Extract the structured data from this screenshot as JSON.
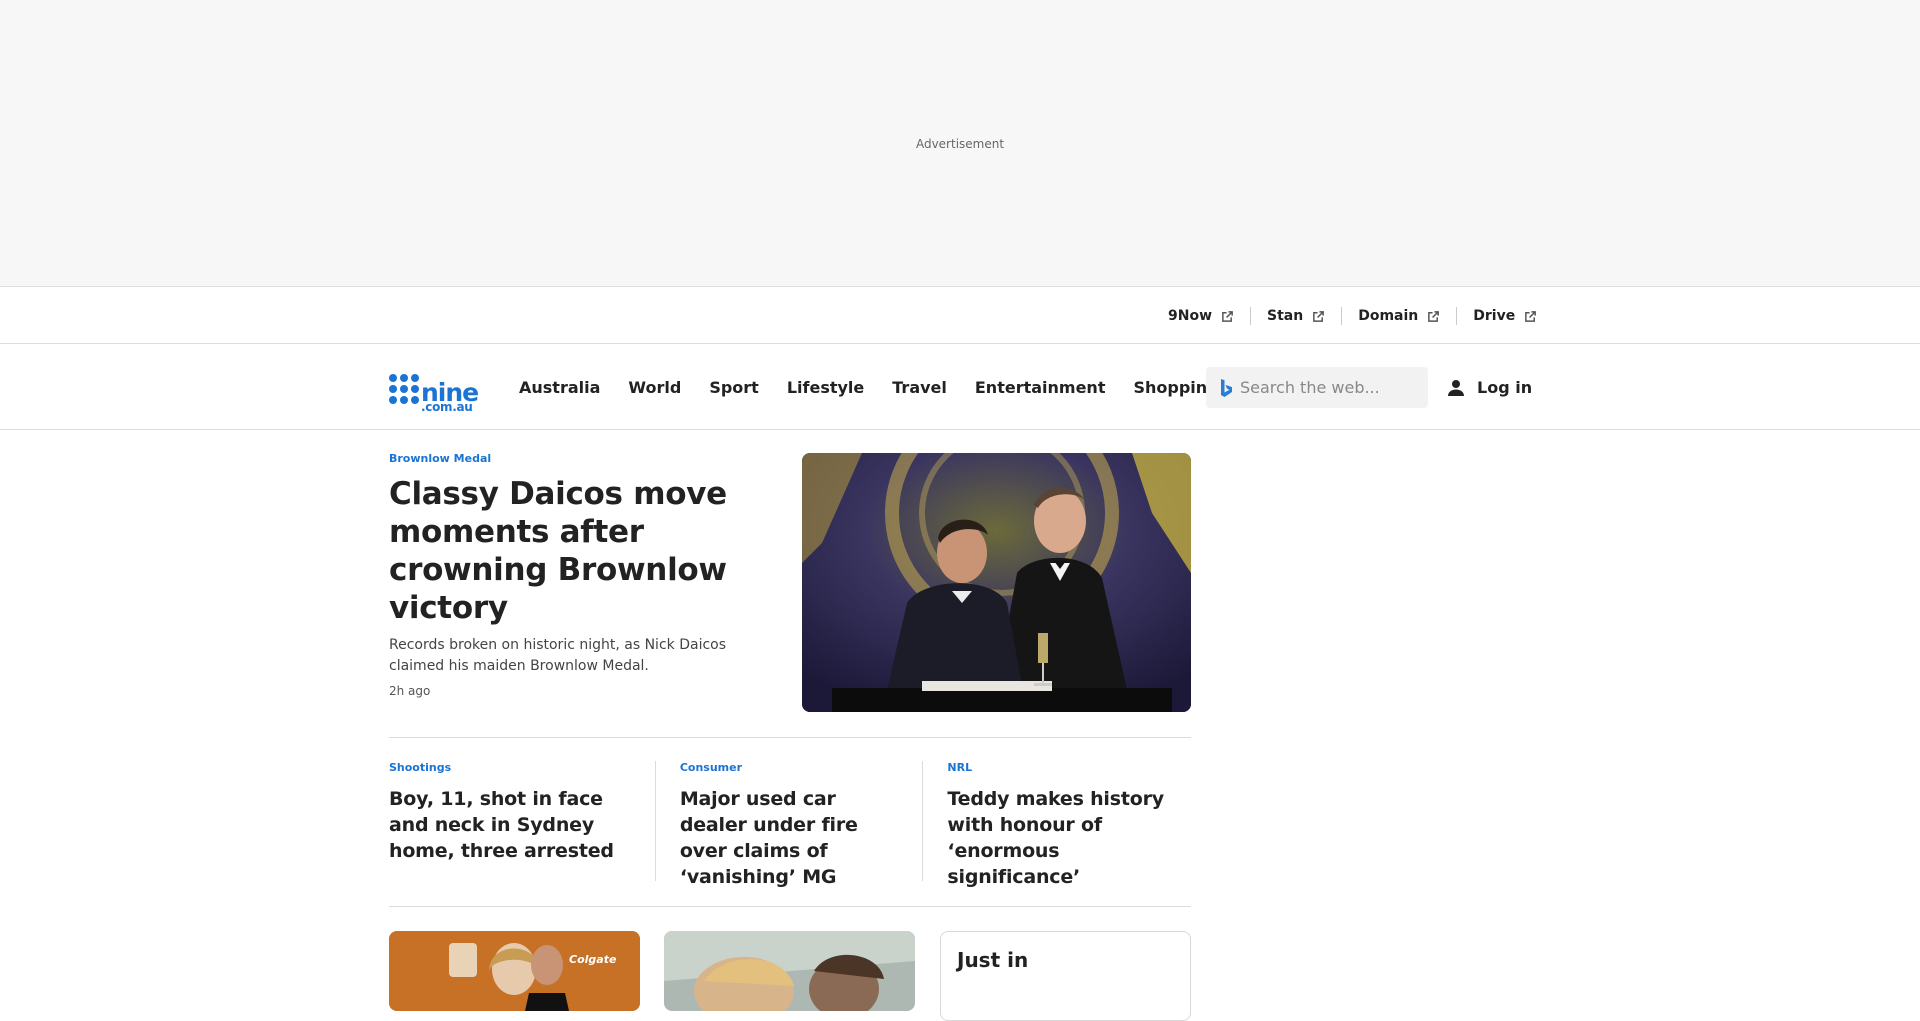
{
  "ad": {
    "label": "Advertisement"
  },
  "utility_links": [
    {
      "label": "9Now"
    },
    {
      "label": "Stan"
    },
    {
      "label": "Domain"
    },
    {
      "label": "Drive"
    }
  ],
  "logo": {
    "main": "nine",
    "sub": ".com.au"
  },
  "nav": {
    "items": [
      {
        "label": "Australia"
      },
      {
        "label": "World"
      },
      {
        "label": "Sport"
      },
      {
        "label": "Lifestyle"
      },
      {
        "label": "Travel"
      },
      {
        "label": "Entertainment"
      },
      {
        "label": "Shopping"
      }
    ]
  },
  "search": {
    "placeholder": "Search the web..."
  },
  "login": {
    "label": "Log in"
  },
  "hero": {
    "kicker": "Brownlow Medal",
    "title": "Classy Daicos move moments after crowning Brownlow victory",
    "description": "Records broken on historic night, as Nick Daicos claimed his maiden Brownlow Medal.",
    "time": "2h ago"
  },
  "stories": [
    {
      "kicker": "Shootings",
      "title": "Boy, 11, shot in face and neck in Sydney home, three arrested"
    },
    {
      "kicker": "Consumer",
      "title": "Major used car dealer under fire over claims of ‘vanishing’ MG"
    },
    {
      "kicker": "NRL",
      "title": "Teddy makes history with honour of ‘enormous significance’"
    }
  ],
  "just_in": {
    "title": "Just in"
  },
  "colors": {
    "brand": "#1b73d4",
    "text": "#222222",
    "ad_bg": "#f7f7f7"
  }
}
